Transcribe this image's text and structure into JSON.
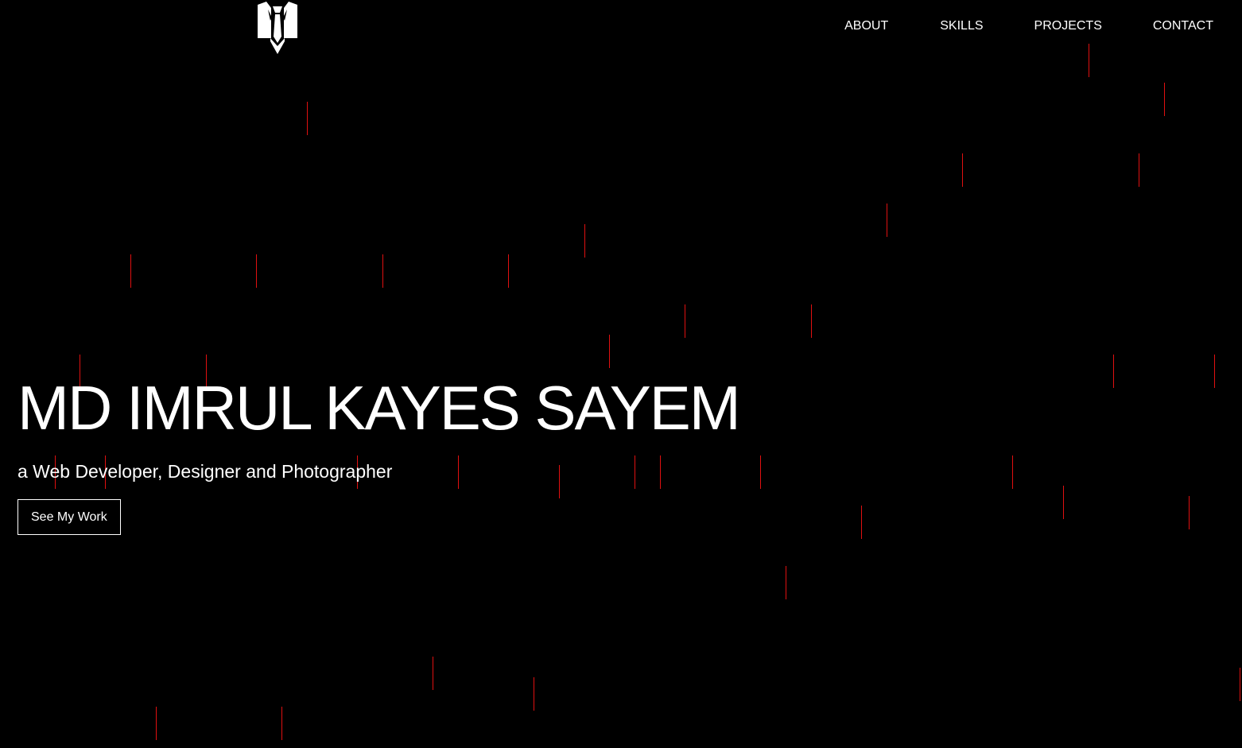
{
  "colors": {
    "background": "#000000",
    "text": "#ffffff",
    "rain": "#e01010"
  },
  "header": {
    "logo_icon": "suit-tie-logo-icon"
  },
  "nav": {
    "items": [
      {
        "label": "ABOUT"
      },
      {
        "label": "SKILLS"
      },
      {
        "label": "PROJECTS"
      },
      {
        "label": "CONTACT"
      }
    ]
  },
  "hero": {
    "name": "MD IMRUL KAYES SAYEM",
    "tagline": "a Web Developer, Designer and Photographer",
    "button_label": "See My Work"
  }
}
